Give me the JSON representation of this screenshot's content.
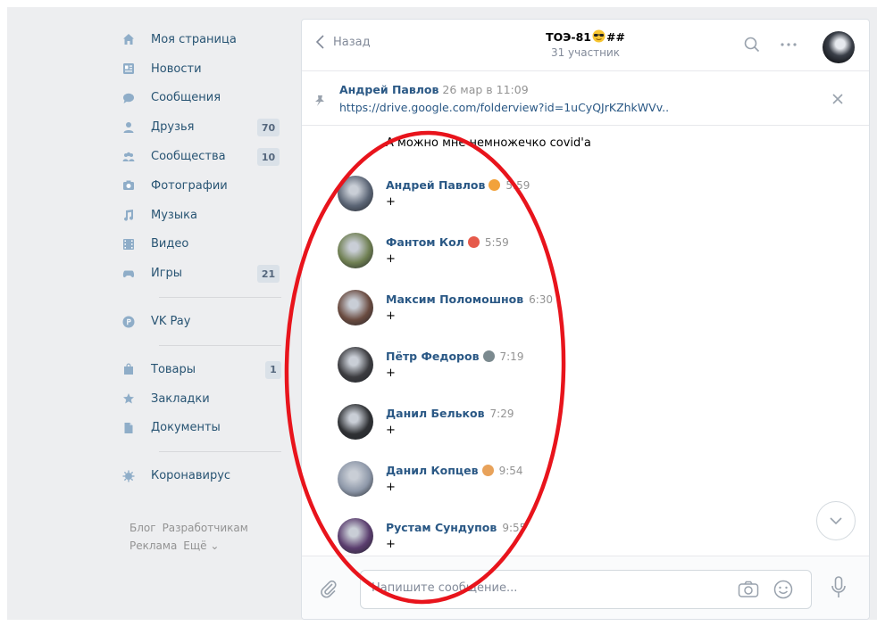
{
  "sidebar": {
    "items": [
      {
        "label": "Моя страница",
        "icon": "home-icon"
      },
      {
        "label": "Новости",
        "icon": "news-icon"
      },
      {
        "label": "Сообщения",
        "icon": "messages-icon"
      },
      {
        "label": "Друзья",
        "icon": "friends-icon",
        "count": "70"
      },
      {
        "label": "Сообщества",
        "icon": "communities-icon",
        "count": "10"
      },
      {
        "label": "Фотографии",
        "icon": "camera-icon"
      },
      {
        "label": "Музыка",
        "icon": "music-icon"
      },
      {
        "label": "Видео",
        "icon": "video-icon"
      },
      {
        "label": "Игры",
        "icon": "gamepad-icon",
        "count": "21"
      }
    ],
    "vkpay": "VK Pay",
    "items2": [
      {
        "label": "Товары",
        "icon": "bag-icon",
        "count": "1"
      },
      {
        "label": "Закладки",
        "icon": "star-icon"
      },
      {
        "label": "Документы",
        "icon": "document-icon"
      }
    ],
    "corona": "Коронавирус",
    "footer": [
      "Блог",
      "Разработчикам",
      "Реклама",
      "Ещё ⌄"
    ]
  },
  "header": {
    "back_label": "Назад",
    "title": "ТОЭ-81",
    "title_suffix": "##",
    "subtitle": "31 участник"
  },
  "pinned": {
    "author": "Андрей Павлов",
    "time": "26 мар в 11:09",
    "link": "https://drive.google.com/folderview?id=1uCyQJrKZhkWVv.."
  },
  "continuation_text": "А можно мне немножечко covid'a",
  "messages": [
    {
      "name": "Андрей Павлов",
      "time": "5:59",
      "text": "+",
      "emoji": "person-emoji",
      "avatar": "#5b6575"
    },
    {
      "name": "Фантом Кол",
      "time": "5:59",
      "text": "+",
      "emoji": "clown-emoji",
      "avatar": "#6f7f52"
    },
    {
      "name": "Максим Поломошнов",
      "time": "6:30",
      "text": "+",
      "emoji": "",
      "avatar": "#6a4b40"
    },
    {
      "name": "Пётр Федоров",
      "time": "7:19",
      "text": "+",
      "emoji": "alien-emoji",
      "avatar": "#3c3c40"
    },
    {
      "name": "Данил Бельков",
      "time": "7:29",
      "text": "+",
      "emoji": "",
      "avatar": "#2f3134"
    },
    {
      "name": "Данил Копцев",
      "time": "9:54",
      "text": "+",
      "emoji": "cat-emoji",
      "avatar": "#8d97a8"
    },
    {
      "name": "Рустам Сундупов",
      "time": "9:55",
      "text": "+",
      "emoji": "",
      "avatar": "#5a3d6e"
    }
  ],
  "composer": {
    "placeholder": "Напишите сообщение..."
  },
  "colors": {
    "link": "#2a5885",
    "annotation": "#e8141c"
  }
}
